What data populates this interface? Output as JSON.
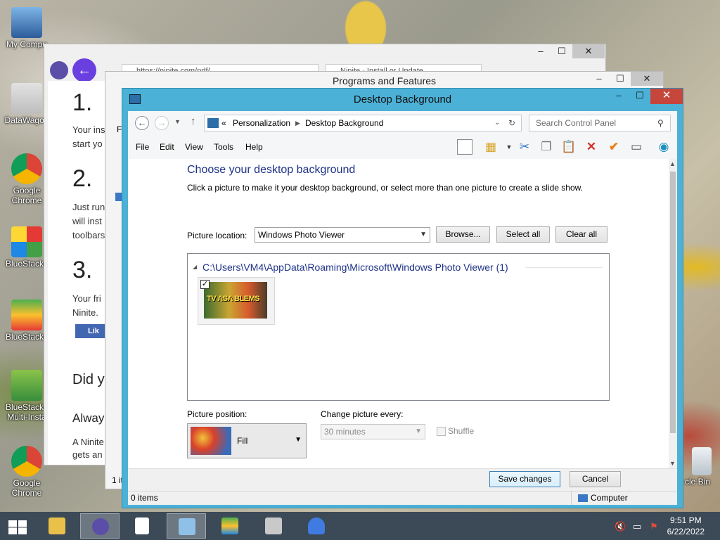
{
  "desktop": {
    "icons": [
      {
        "label": "My Compu"
      },
      {
        "label": "DataWagon"
      },
      {
        "label": "Google Chrome"
      },
      {
        "label": "BlueStacks"
      },
      {
        "label": "BlueStacks"
      },
      {
        "label": "BlueStacks Multi-Insta"
      },
      {
        "label": "Google Chrome"
      },
      {
        "label": "cle Bin"
      }
    ]
  },
  "browser": {
    "url": "https://ninite.com/pdf/...",
    "tab_label": "Ninite - Install or Update...",
    "steps": [
      {
        "num": "1.",
        "text": "Your ins",
        "text2": "start yo"
      },
      {
        "num": "2.",
        "text": "Just run",
        "text2": "will inst",
        "text3": "toolbars"
      },
      {
        "num": "3.",
        "text": "Your fri",
        "text2": "Ninite."
      }
    ],
    "like_label": "Lik",
    "did_heading": "Did y",
    "always_heading": "Alway",
    "para": "A Ninite",
    "para2": "gets an"
  },
  "programs_window": {
    "title": "Programs and Features",
    "menu_stub": "Fi",
    "status_stub": "1 it"
  },
  "dialog": {
    "title": "Desktop Background",
    "address": {
      "chevrons": "«",
      "segment1": "Personalization",
      "segment2": "Desktop Background"
    },
    "search_placeholder": "Search Control Panel",
    "menu": [
      "File",
      "Edit",
      "View",
      "Tools",
      "Help"
    ],
    "heading": "Choose your desktop background",
    "subtitle": "Click a picture to make it your desktop background, or select more than one picture to create a slide show.",
    "picture_location_label": "Picture location:",
    "picture_location_value": "Windows Photo Viewer",
    "browse_label": "Browse...",
    "select_all_label": "Select all",
    "clear_all_label": "Clear all",
    "folder_label": "C:\\Users\\VM4\\AppData\\Roaming\\Microsoft\\Windows Photo Viewer (1)",
    "thumbnail_text": "TV ASA BLEMS",
    "thumbnail_checked": true,
    "picture_position_label": "Picture position:",
    "picture_position_value": "Fill",
    "change_every_label": "Change picture every:",
    "change_every_value": "30 minutes",
    "shuffle_label": "Shuffle",
    "save_label": "Save changes",
    "cancel_label": "Cancel",
    "status_items": "0 items",
    "status_computer": "Computer"
  },
  "taskbar": {
    "time": "9:51 PM",
    "date": "6/22/2022"
  }
}
